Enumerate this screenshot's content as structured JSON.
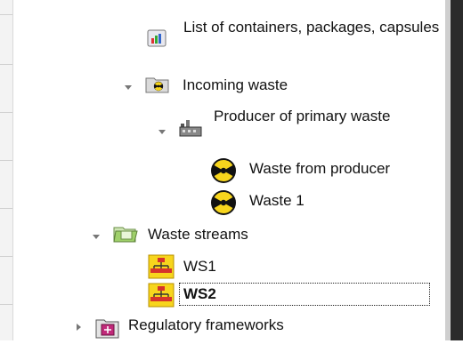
{
  "tree": {
    "containers_list": {
      "label": "List of containers, packages, capsules",
      "icon": "chart-icon"
    },
    "incoming_waste": {
      "label": "Incoming waste",
      "icon": "radiation-folder-icon"
    },
    "producer_primary": {
      "label": "Producer of primary waste",
      "icon": "factory-icon"
    },
    "waste_from_producer": {
      "label": "Waste from producer",
      "icon": "radiation-icon"
    },
    "waste_1": {
      "label": "Waste 1",
      "icon": "radiation-icon"
    },
    "waste_streams": {
      "label": "Waste streams",
      "icon": "folder-icon"
    },
    "ws1": {
      "label": "WS1",
      "icon": "network-icon"
    },
    "ws2": {
      "label": "WS2",
      "icon": "network-icon",
      "selected": true
    },
    "regulatory": {
      "label": "Regulatory frameworks",
      "icon": "regulatory-icon"
    }
  },
  "colors": {
    "accent_green": "#7fbf3f",
    "radiation_yellow": "#f7d51d",
    "network_red": "#d6332b"
  }
}
